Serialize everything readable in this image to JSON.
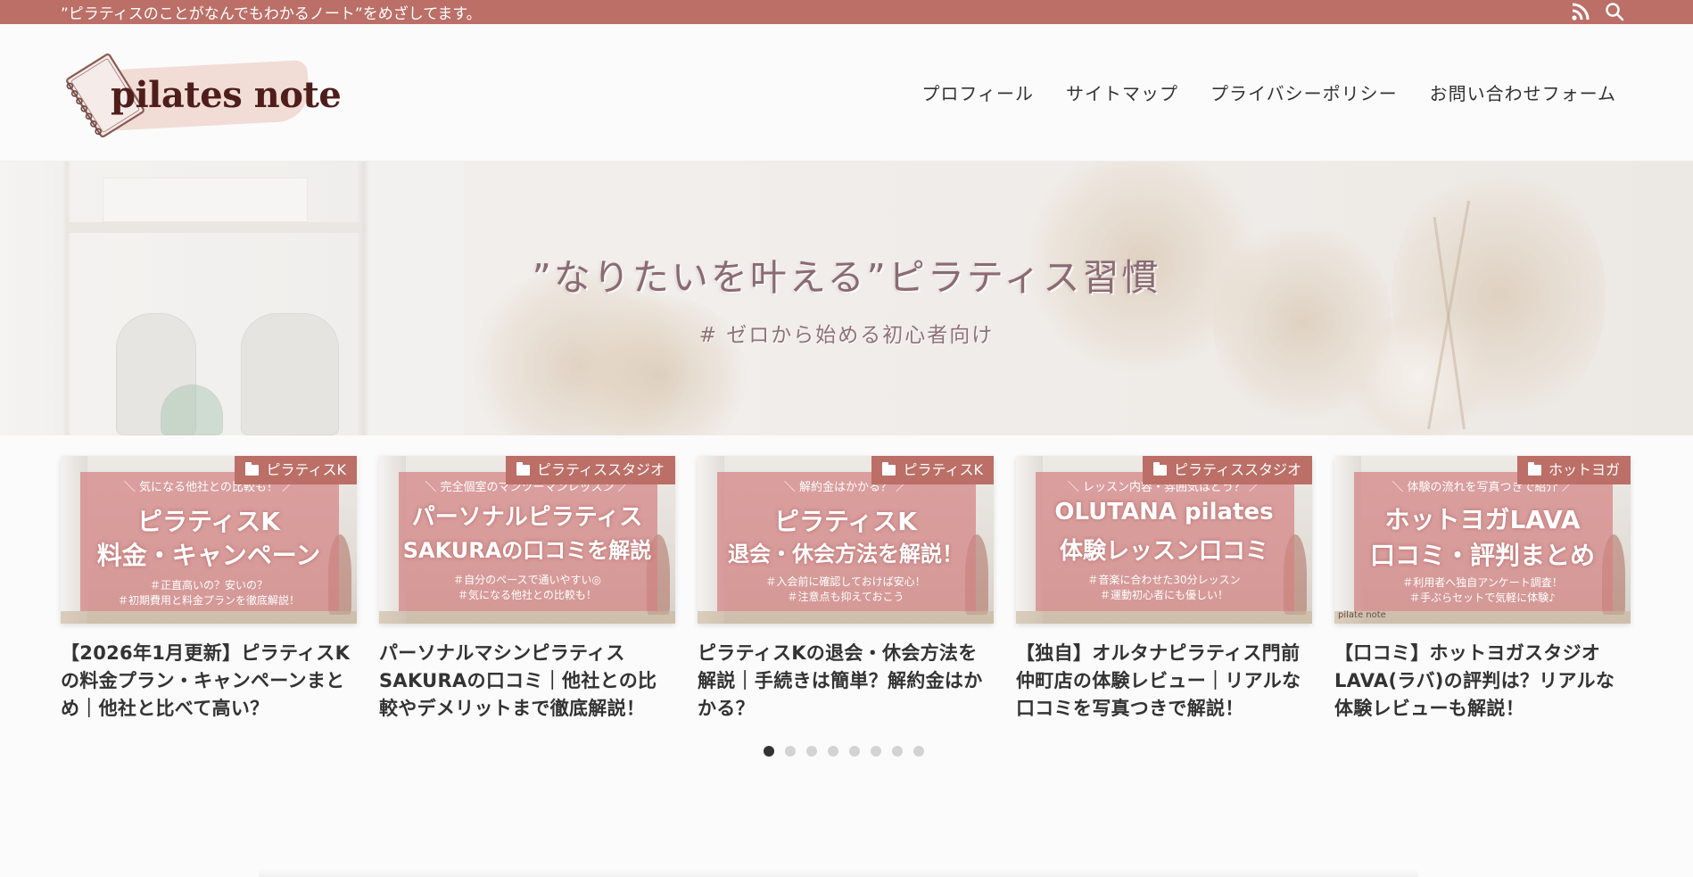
{
  "topbar": {
    "tagline": "”ピラティスのことがなんでもわかるノート”をめざしてます。",
    "icons": [
      "rss-icon",
      "search-icon"
    ]
  },
  "header": {
    "logo_text": "pilates note",
    "nav": [
      "プロフィール",
      "サイトマップ",
      "プライバシーポリシー",
      "お問い合わせフォーム"
    ]
  },
  "hero": {
    "title": "”なりたいを叶える”ピラティス習慣",
    "subtitle": "# ゼロから始める初心者向け"
  },
  "cards": [
    {
      "category": "ピラティスK",
      "thumb_kicker": "＼ 気になる他社との比較も！ ／",
      "thumb_lines": [
        "ピラティスK",
        "料金・キャンペーン"
      ],
      "thumb_tags": [
        "＃正直高いの？安いの？",
        "＃初期費用と料金プランを徹底解説！"
      ],
      "thumb_mark": "",
      "title": "【2026年1月更新】ピラティスKの料金プラン・キャンペーンまとめ｜他社と比べて高い？"
    },
    {
      "category": "ピラティススタジオ",
      "thumb_kicker": "＼ 完全個室のマンツーマンレッスン ／",
      "thumb_lines": [
        "パーソナルピラティス",
        "SAKURAの口コミを解説"
      ],
      "thumb_tags": [
        "＃自分のペースで通いやすい◎",
        "＃気になる他社との比較も！"
      ],
      "thumb_mark": "",
      "title": "パーソナルマシンピラティスSAKURAの口コミ｜他社との比較やデメリットまで徹底解説！"
    },
    {
      "category": "ピラティスK",
      "thumb_kicker": "＼ 解約金はかかる？ ／",
      "thumb_lines": [
        "ピラティスK",
        "退会・休会方法を解説！"
      ],
      "thumb_tags": [
        "＃入会前に確認しておけば安心！",
        "＃注意点も抑えておこう"
      ],
      "thumb_mark": "",
      "title": "ピラティスKの退会・休会方法を解説｜手続きは簡単？解約金はかかる？"
    },
    {
      "category": "ピラティススタジオ",
      "thumb_kicker": "＼ レッスン内容・雰囲気はどう？ ／",
      "thumb_lines": [
        "OLUTANA pilates",
        "体験レッスン口コミ"
      ],
      "thumb_tags": [
        "＃音楽に合わせた30分レッスン",
        "＃運動初心者にも優しい！"
      ],
      "thumb_mark": "",
      "title": "【独自】オルタナピラティス門前仲町店の体験レビュー｜リアルな口コミを写真つきで解説！"
    },
    {
      "category": "ホットヨガ",
      "thumb_kicker": "＼ 体験の流れを写真つきで紹介 ／",
      "thumb_lines": [
        "ホットヨガLAVA",
        "口コミ・評判まとめ"
      ],
      "thumb_tags": [
        "＃利用者へ独自アンケート調査！",
        "＃手ぶらセットで気軽に体験♪"
      ],
      "thumb_mark": "pilate note",
      "title": "【口コミ】ホットヨガスタジオLAVA(ラバ)の評判は？リアルな体験レビューも解説！"
    }
  ],
  "carousel": {
    "total": 8,
    "active": 0
  },
  "colors": {
    "accent": "#bb6f67",
    "hero_text": "#8a6b73"
  }
}
